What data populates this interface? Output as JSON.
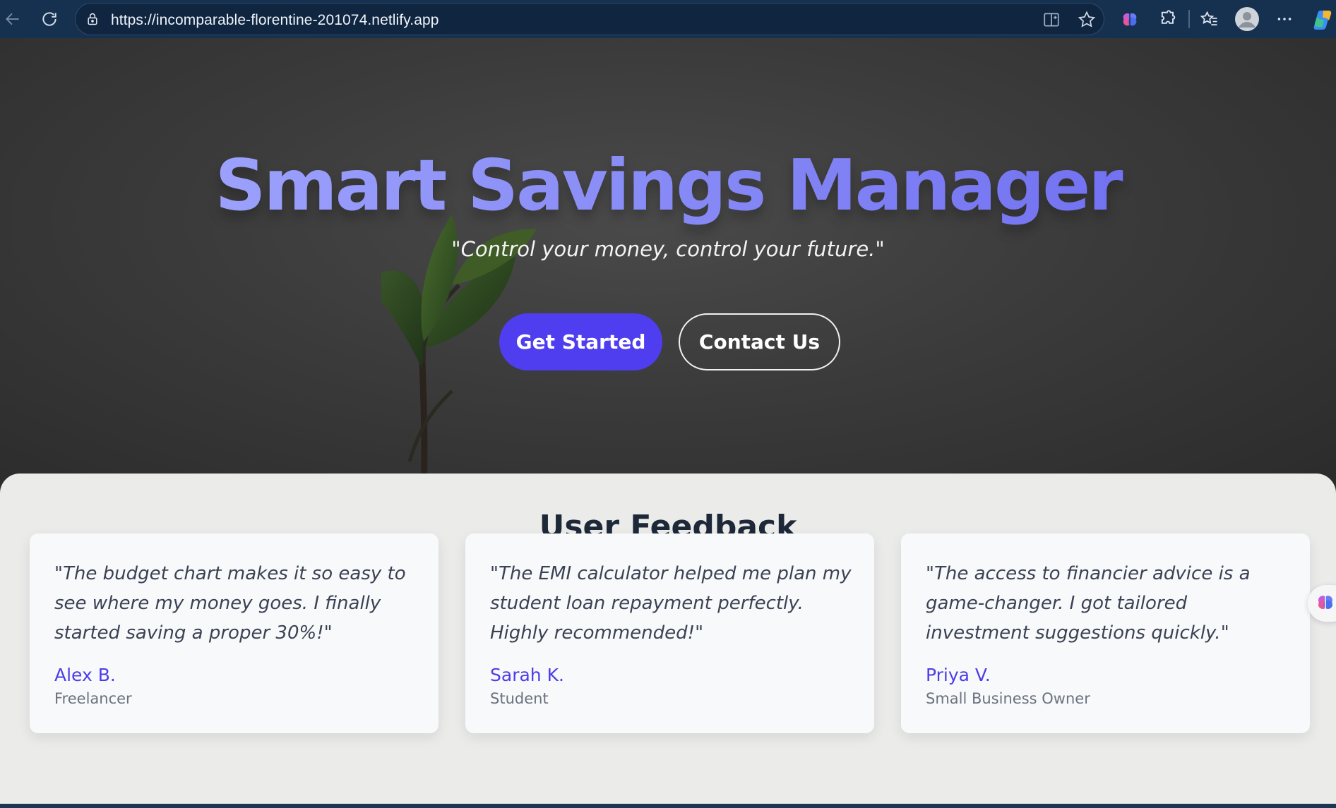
{
  "browser": {
    "url": "https://incomparable-florentine-201074.netlify.app"
  },
  "hero": {
    "title": "Smart Savings Manager",
    "tagline": "\"Control your money, control your future.\"",
    "primary_button": "Get Started",
    "secondary_button": "Contact Us"
  },
  "feedback": {
    "heading": "User Feedback",
    "cards": [
      {
        "quote": "\"The budget chart makes it so easy to see where my money goes. I finally started saving a proper 30%!\"",
        "author": "Alex B.",
        "role": "Freelancer"
      },
      {
        "quote": "\"The EMI calculator helped me plan my student loan repayment perfectly. Highly recommended!\"",
        "author": "Sarah K.",
        "role": "Student"
      },
      {
        "quote": "\"The access to financier advice is a game-changer. I got tailored investment suggestions quickly.\"",
        "author": "Priya V.",
        "role": "Small Business Owner"
      }
    ]
  },
  "colors": {
    "brand_primary": "#4f3df0",
    "author_name": "#4d3de8",
    "heading_dark": "#1d2839"
  }
}
